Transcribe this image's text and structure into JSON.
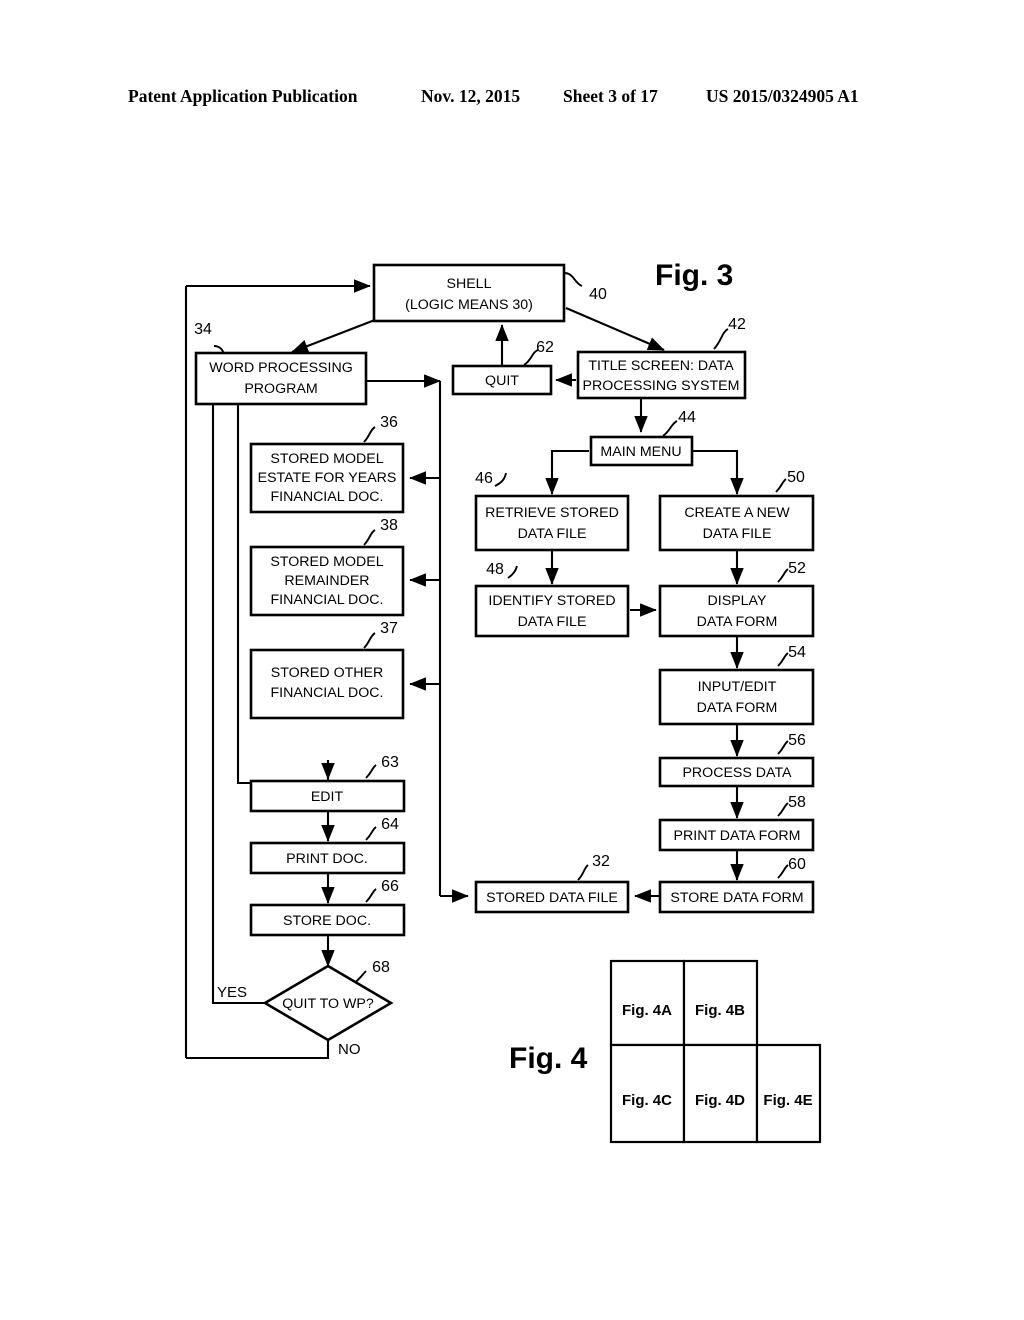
{
  "page_header": {
    "publication": "Patent Application Publication",
    "date": "Nov. 12, 2015",
    "sheet": "Sheet 3 of 17",
    "patent_number": "US 2015/0324905 A1"
  },
  "figure3": {
    "title": "Fig. 3",
    "nodes": {
      "shell": {
        "line1": "SHELL",
        "line2": "(LOGIC MEANS 30)",
        "ref": "40"
      },
      "word_processing": {
        "line1": "WORD PROCESSING",
        "line2": "PROGRAM",
        "ref": "34"
      },
      "quit": {
        "line1": "QUIT",
        "ref": "62"
      },
      "title_screen": {
        "line1": "TITLE SCREEN: DATA",
        "line2": "PROCESSING SYSTEM",
        "ref": "42"
      },
      "main_menu": {
        "line1": "MAIN MENU",
        "ref": "44"
      },
      "retrieve_stored": {
        "line1": "RETRIEVE STORED",
        "line2": "DATA FILE",
        "ref": "46"
      },
      "create_new": {
        "line1": "CREATE A NEW",
        "line2": "DATA FILE",
        "ref": "50"
      },
      "identify_stored": {
        "line1": "IDENTIFY STORED",
        "line2": "DATA FILE",
        "ref": "48"
      },
      "display_form": {
        "line1": "DISPLAY",
        "line2": "DATA FORM",
        "ref": "52"
      },
      "input_edit_form": {
        "line1": "INPUT/EDIT",
        "line2": "DATA FORM",
        "ref": "54"
      },
      "process_data": {
        "line1": "PROCESS DATA",
        "ref": "56"
      },
      "print_data_form": {
        "line1": "PRINT DATA FORM",
        "ref": "58"
      },
      "store_data_form": {
        "line1": "STORE DATA FORM",
        "ref": "60"
      },
      "stored_data_file": {
        "line1": "STORED DATA FILE",
        "ref": "32"
      },
      "stored_model_estate": {
        "line1": "STORED MODEL",
        "line2": "ESTATE FOR YEARS",
        "line3": "FINANCIAL DOC.",
        "ref": "36"
      },
      "stored_model_remainder": {
        "line1": "STORED MODEL",
        "line2": "REMAINDER",
        "line3": "FINANCIAL DOC.",
        "ref": "38"
      },
      "stored_other": {
        "line1": "STORED OTHER",
        "line2": "FINANCIAL DOC.",
        "ref": "37"
      },
      "edit": {
        "line1": "EDIT",
        "ref": "63"
      },
      "print_doc": {
        "line1": "PRINT DOC.",
        "ref": "64"
      },
      "store_doc": {
        "line1": "STORE DOC.",
        "ref": "66"
      },
      "quit_to_wp": {
        "line1": "QUIT TO WP?",
        "ref": "68"
      }
    },
    "branch_labels": {
      "yes": "YES",
      "no": "NO"
    }
  },
  "figure4": {
    "title": "Fig. 4",
    "cells": [
      {
        "label": "Fig. 4A"
      },
      {
        "label": "Fig. 4B"
      },
      {
        "label": "Fig. 4C"
      },
      {
        "label": "Fig. 4D"
      },
      {
        "label": "Fig. 4E"
      }
    ]
  }
}
